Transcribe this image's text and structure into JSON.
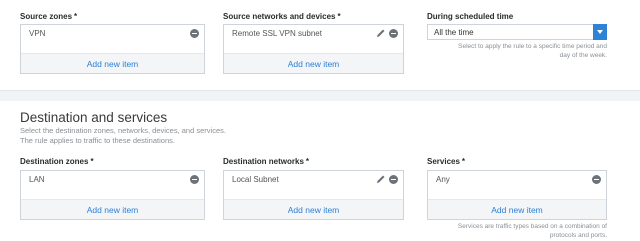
{
  "source": {
    "zones": {
      "label": "Source zones",
      "required": "*",
      "items": [
        "VPN"
      ],
      "add_label": "Add new item"
    },
    "networks": {
      "label": "Source networks and devices",
      "required": "*",
      "items": [
        "Remote SSL VPN subnet"
      ],
      "add_label": "Add new item"
    },
    "schedule": {
      "label": "During scheduled time",
      "value": "All the time",
      "hint_line1": "Select to apply the rule to a specific time period and",
      "hint_line2": "day of the week."
    }
  },
  "destination": {
    "title": "Destination and services",
    "desc_line1": "Select the destination zones, networks, devices, and services.",
    "desc_line2": "The rule applies to traffic to these destinations.",
    "zones": {
      "label": "Destination zones",
      "required": "*",
      "items": [
        "LAN"
      ],
      "add_label": "Add new item"
    },
    "networks": {
      "label": "Destination networks",
      "required": "*",
      "items": [
        "Local Subnet"
      ],
      "add_label": "Add new item"
    },
    "services": {
      "label": "Services",
      "required": "*",
      "items": [
        "Any"
      ],
      "add_label": "Add new item",
      "hint_line1": "Services are traffic types based on a combination of",
      "hint_line2": "protocols and ports."
    }
  },
  "colors": {
    "accent": "#2e83d6",
    "link": "#2b7fd6",
    "border": "#cfd4da"
  }
}
